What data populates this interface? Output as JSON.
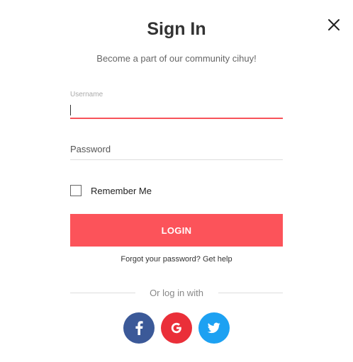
{
  "modal": {
    "title": "Sign In",
    "subtitle": "Become a part of our community cihuy!",
    "close_icon": "close-icon"
  },
  "form": {
    "username_label": "Username",
    "username_value": "",
    "password_placeholder": "Password",
    "remember_label": "Remember Me",
    "remember_checked": false,
    "login_label": "LOGIN",
    "forgot_text": "Forgot your password?",
    "help_link": "Get help"
  },
  "social": {
    "divider_text": "Or log in with",
    "providers": [
      {
        "name": "facebook",
        "icon": "facebook-icon",
        "color": "#3b5998"
      },
      {
        "name": "google",
        "icon": "google-icon",
        "color": "#ea2f39"
      },
      {
        "name": "twitter",
        "icon": "twitter-icon",
        "color": "#1da1f2"
      }
    ]
  },
  "colors": {
    "accent": "#fc535a",
    "active_underline": "#f7535a"
  }
}
